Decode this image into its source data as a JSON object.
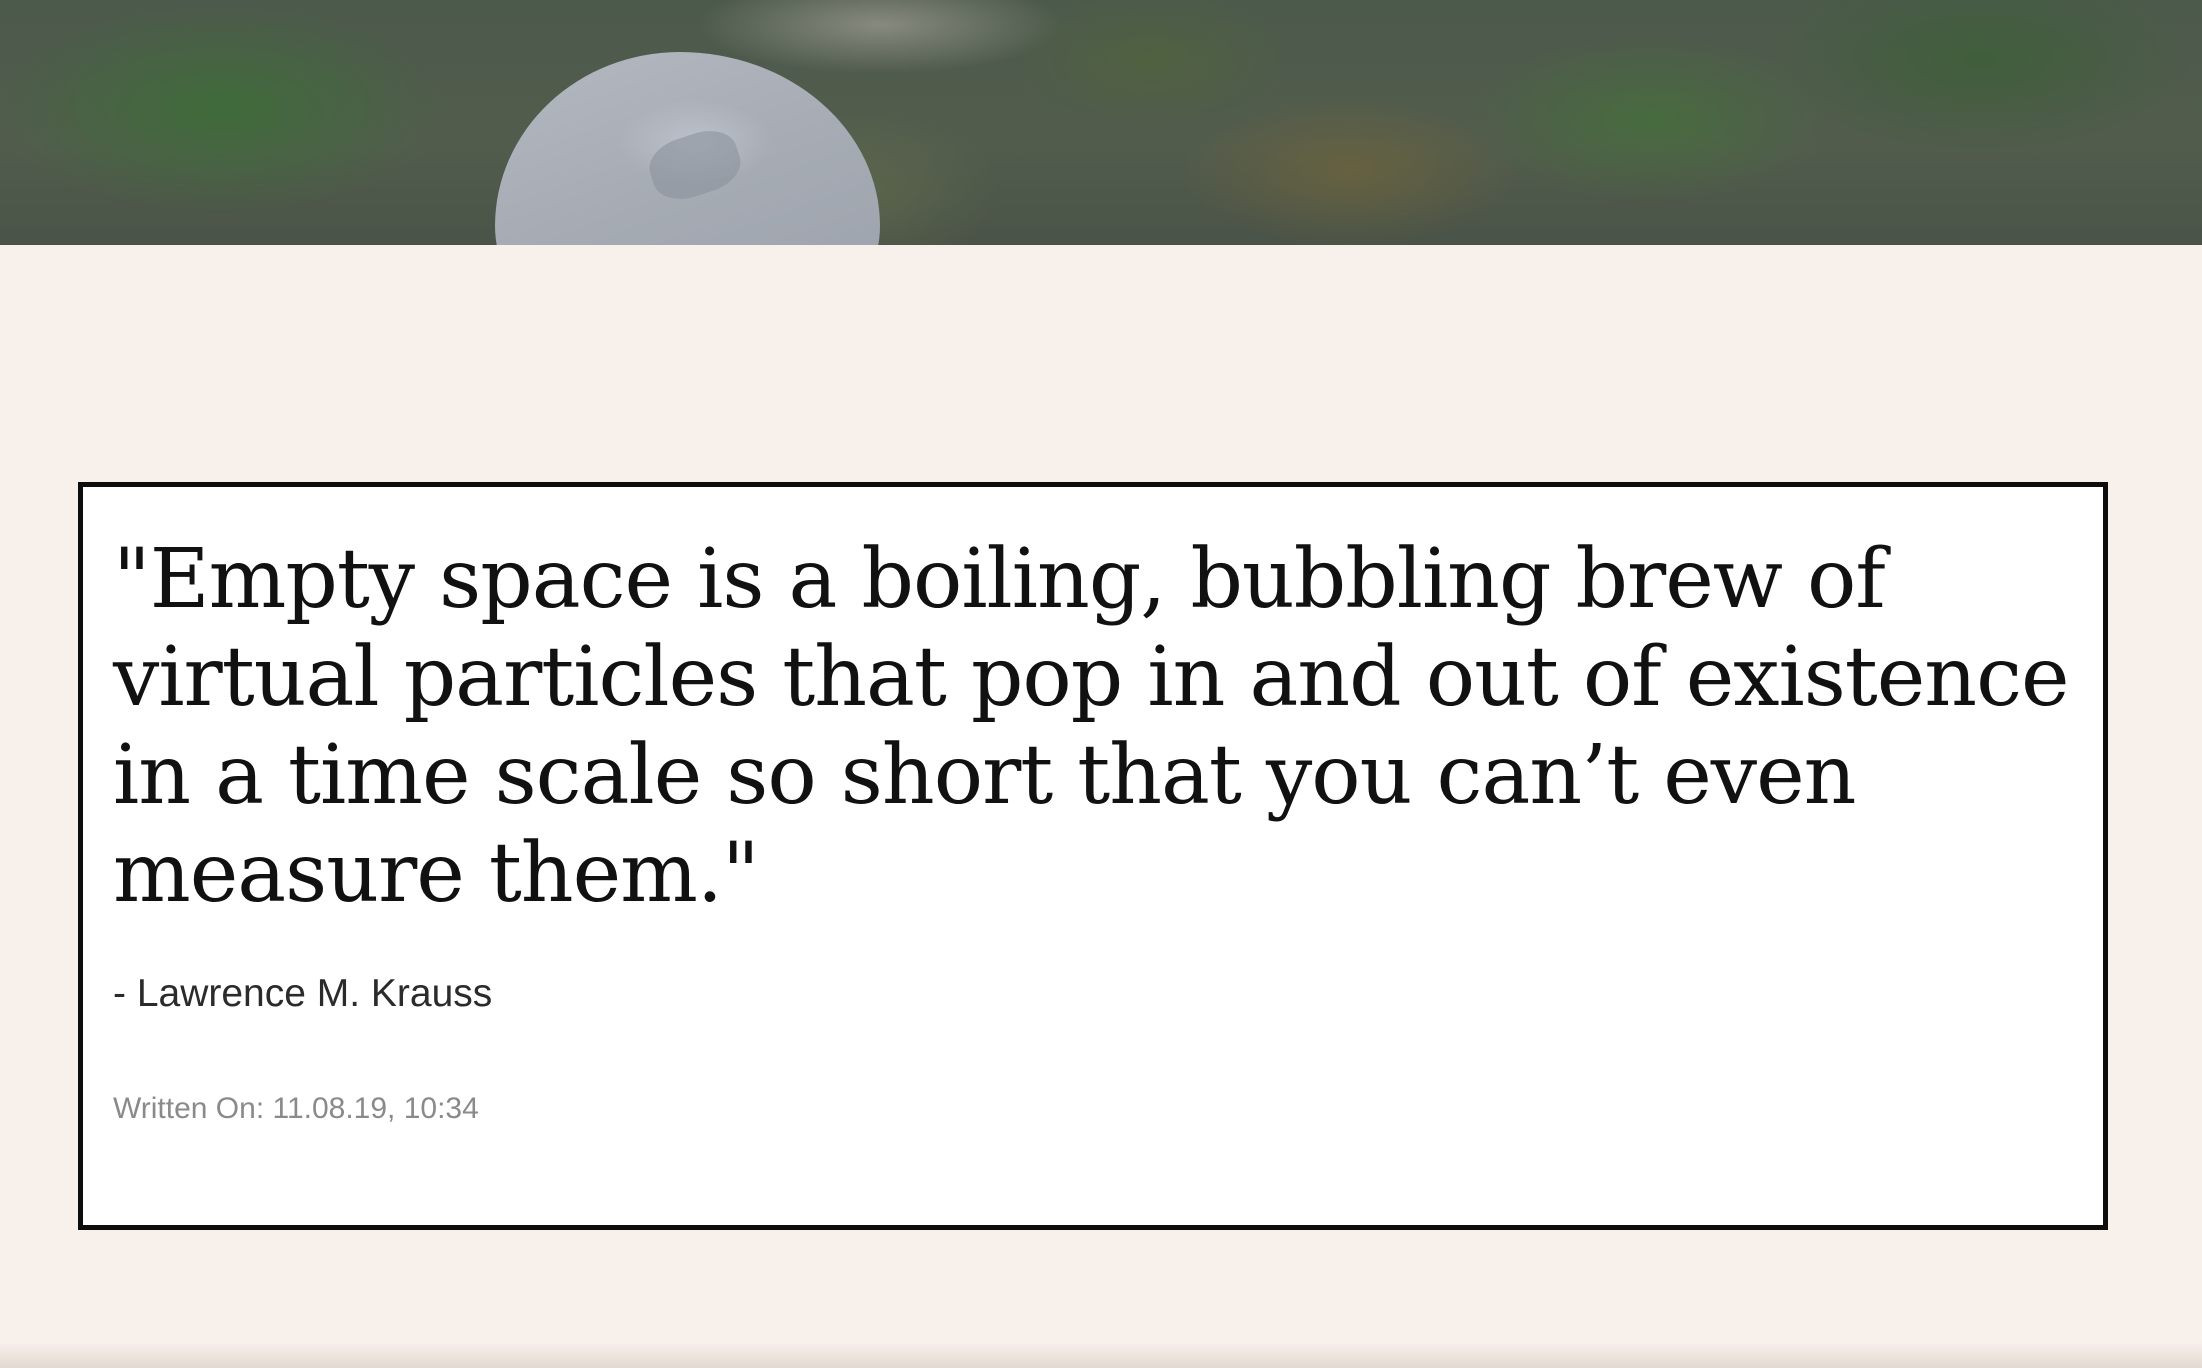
{
  "hero": {
    "image_alt": "Person wearing a grey hood in front of green foliage"
  },
  "quote": {
    "text": "\"Empty space is a boiling, bubbling brew of virtual particles that pop in and out of existence in a time scale so short that you can’t even measure them.\"",
    "author": "- Lawrence M. Krauss",
    "written_on": "Written On: 11.08.19, 10:34"
  },
  "colors": {
    "page_background": "#f8f0eb",
    "card_background": "#ffffff",
    "card_border": "#0d0d0d",
    "quote_text": "#111111",
    "meta_text": "#8a8a8a"
  }
}
